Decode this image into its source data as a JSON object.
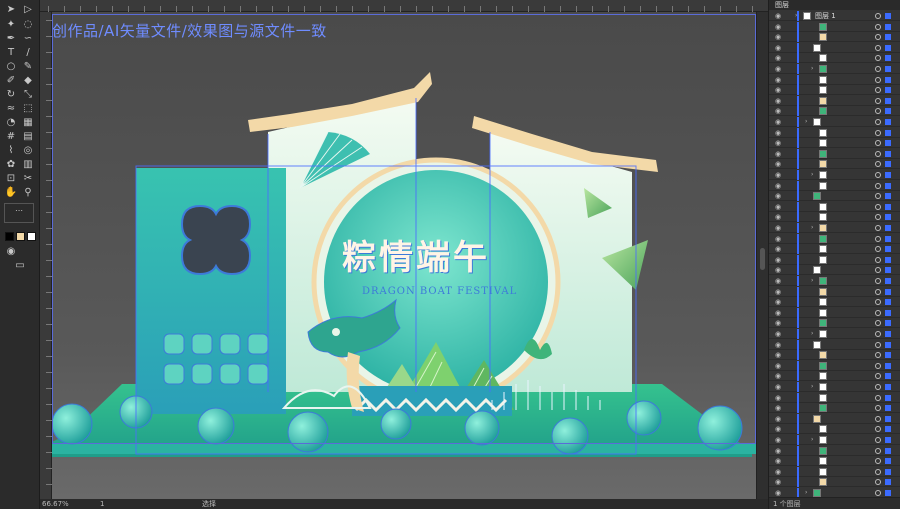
{
  "watermark": "创作品/AI矢量文件/效果图与源文件一致",
  "title_cn": "粽情端午",
  "subtitle_en": "DRAGON BOAT FESTIVAL",
  "status": {
    "zoom": "66.67%",
    "artboard": "1",
    "tool": "选择"
  },
  "layers_panel": {
    "tab": "图层",
    "top_layer": "图层 1",
    "footer": "1 个图层"
  },
  "colors": {
    "teal": "#2fb8a8",
    "mint": "#d9f3e8",
    "cream": "#f3d9a8",
    "green": "#5fb760",
    "accent": "#4a6cff"
  },
  "tools": [
    "selection-tool",
    "direct-selection-tool",
    "magic-wand-tool",
    "lasso-tool",
    "pen-tool",
    "curvature-tool",
    "type-tool",
    "line-tool",
    "rectangle-tool",
    "paintbrush-tool",
    "shaper-tool",
    "eraser-tool",
    "rotate-tool",
    "scale-tool",
    "width-tool",
    "free-transform-tool",
    "shape-builder-tool",
    "perspective-tool",
    "mesh-tool",
    "gradient-tool",
    "eyedropper-tool",
    "blend-tool",
    "symbol-sprayer-tool",
    "column-graph-tool",
    "artboard-tool",
    "slice-tool",
    "hand-tool",
    "zoom-tool"
  ]
}
